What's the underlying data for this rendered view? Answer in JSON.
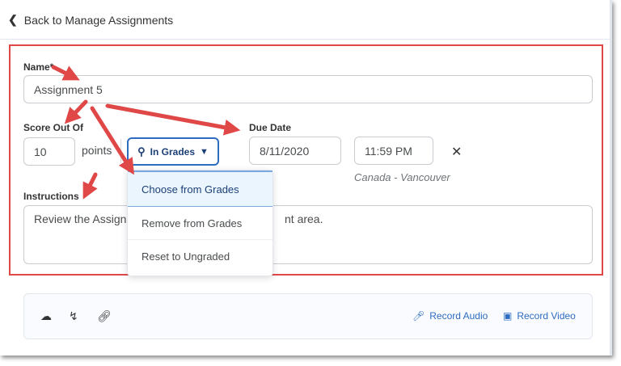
{
  "header": {
    "back_label": "Back to Manage Assignments"
  },
  "form": {
    "name_label": "Name*",
    "name_value": "Assignment 5",
    "score_label": "Score Out Of",
    "score_value": "10",
    "points_label": "points",
    "grades_button": "In Grades",
    "due_label": "Due Date",
    "due_date": "8/11/2020",
    "due_time": "11:59 PM",
    "timezone": "Canada - Vancouver",
    "instructions_label": "Instructions",
    "instructions_visible_start": "Review the Assignm",
    "instructions_visible_end": "nt area."
  },
  "dropdown": {
    "items": [
      "Choose from Grades",
      "Remove from Grades",
      "Reset to Ungraded"
    ]
  },
  "toolbar": {
    "record_audio": "Record Audio",
    "record_video": "Record Video"
  },
  "colors": {
    "accent": "#2d6cc0",
    "annotation": "#e04848"
  }
}
